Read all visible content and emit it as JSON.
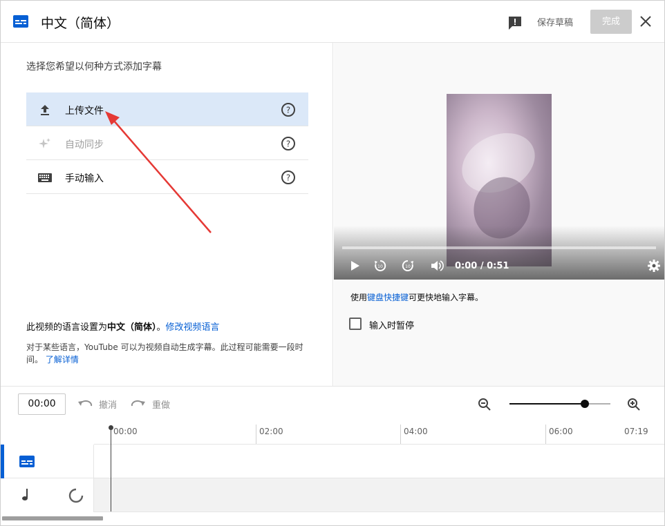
{
  "header": {
    "title": "中文（简体）",
    "save_draft": "保存草稿",
    "done": "完成"
  },
  "left": {
    "prompt": "选择您希望以何种方式添加字幕",
    "options": [
      {
        "label": "上传文件",
        "icon": "upload-icon",
        "state": "selected"
      },
      {
        "label": "自动同步",
        "icon": "sparkle-icon",
        "state": "disabled"
      },
      {
        "label": "手动输入",
        "icon": "keyboard-icon",
        "state": "normal"
      }
    ],
    "lang_prefix": "此视频的语言设置为",
    "lang_value": "中文（简体）",
    "lang_sep": "。",
    "lang_link": "修改视频语言",
    "auto_note": "对于某些语言，YouTube 可以为视频自动生成字幕。此过程可能需要一段时间。",
    "learn_more": "了解详情"
  },
  "player": {
    "time": "0:00 / 0:51",
    "progress": 0
  },
  "right": {
    "kbd_prefix": "使用",
    "kbd_link": "键盘快捷键",
    "kbd_suffix": "可更快地输入字幕。",
    "pause_label": "输入时暂停",
    "pause_checked": false
  },
  "timeline": {
    "current_time": "00:00",
    "undo": "撤消",
    "redo": "重做",
    "ticks": [
      "00:00",
      "02:00",
      "04:00",
      "06:00",
      "07:19"
    ],
    "zoom_level": 0.75
  },
  "colors": {
    "accent": "#065fd4",
    "selected_bg": "#dbe8f8",
    "annotation_arrow": "#e53935"
  }
}
